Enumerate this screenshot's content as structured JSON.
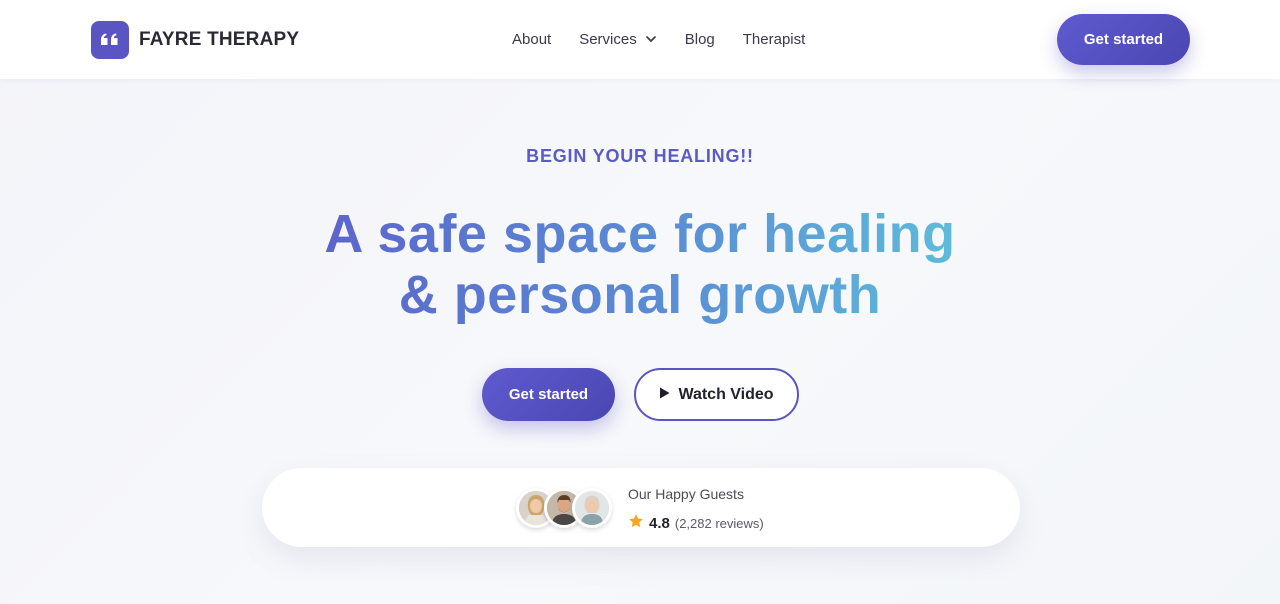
{
  "header": {
    "brand": "FAYRE THERAPY",
    "logo_icon": "quote-icon",
    "nav": [
      {
        "label": "About"
      },
      {
        "label": "Services",
        "icon": "chevron-down-icon"
      },
      {
        "label": "Blog"
      },
      {
        "label": "Therapist"
      }
    ],
    "cta_label": "Get started"
  },
  "hero": {
    "eyebrow": "BEGIN YOUR HEALING!!",
    "headline_line1": "A safe space for healing",
    "headline_line2": "& personal growth",
    "primary_cta": "Get started",
    "secondary_cta": "Watch Video",
    "secondary_icon": "play-icon"
  },
  "reviews": {
    "label": "Our Happy Guests",
    "rating": "4.8",
    "count": "(2,282 reviews)",
    "star_icon": "star-icon",
    "avatars": [
      "avatar-woman-blonde",
      "avatar-man-beard",
      "avatar-woman-grey-hair"
    ]
  },
  "colors": {
    "brand": "#5a55c3",
    "eyebrow": "#5b5bc4",
    "gradient_start": "#5b5bc9",
    "gradient_end": "#5ec9dc",
    "star": "#f5a623"
  }
}
